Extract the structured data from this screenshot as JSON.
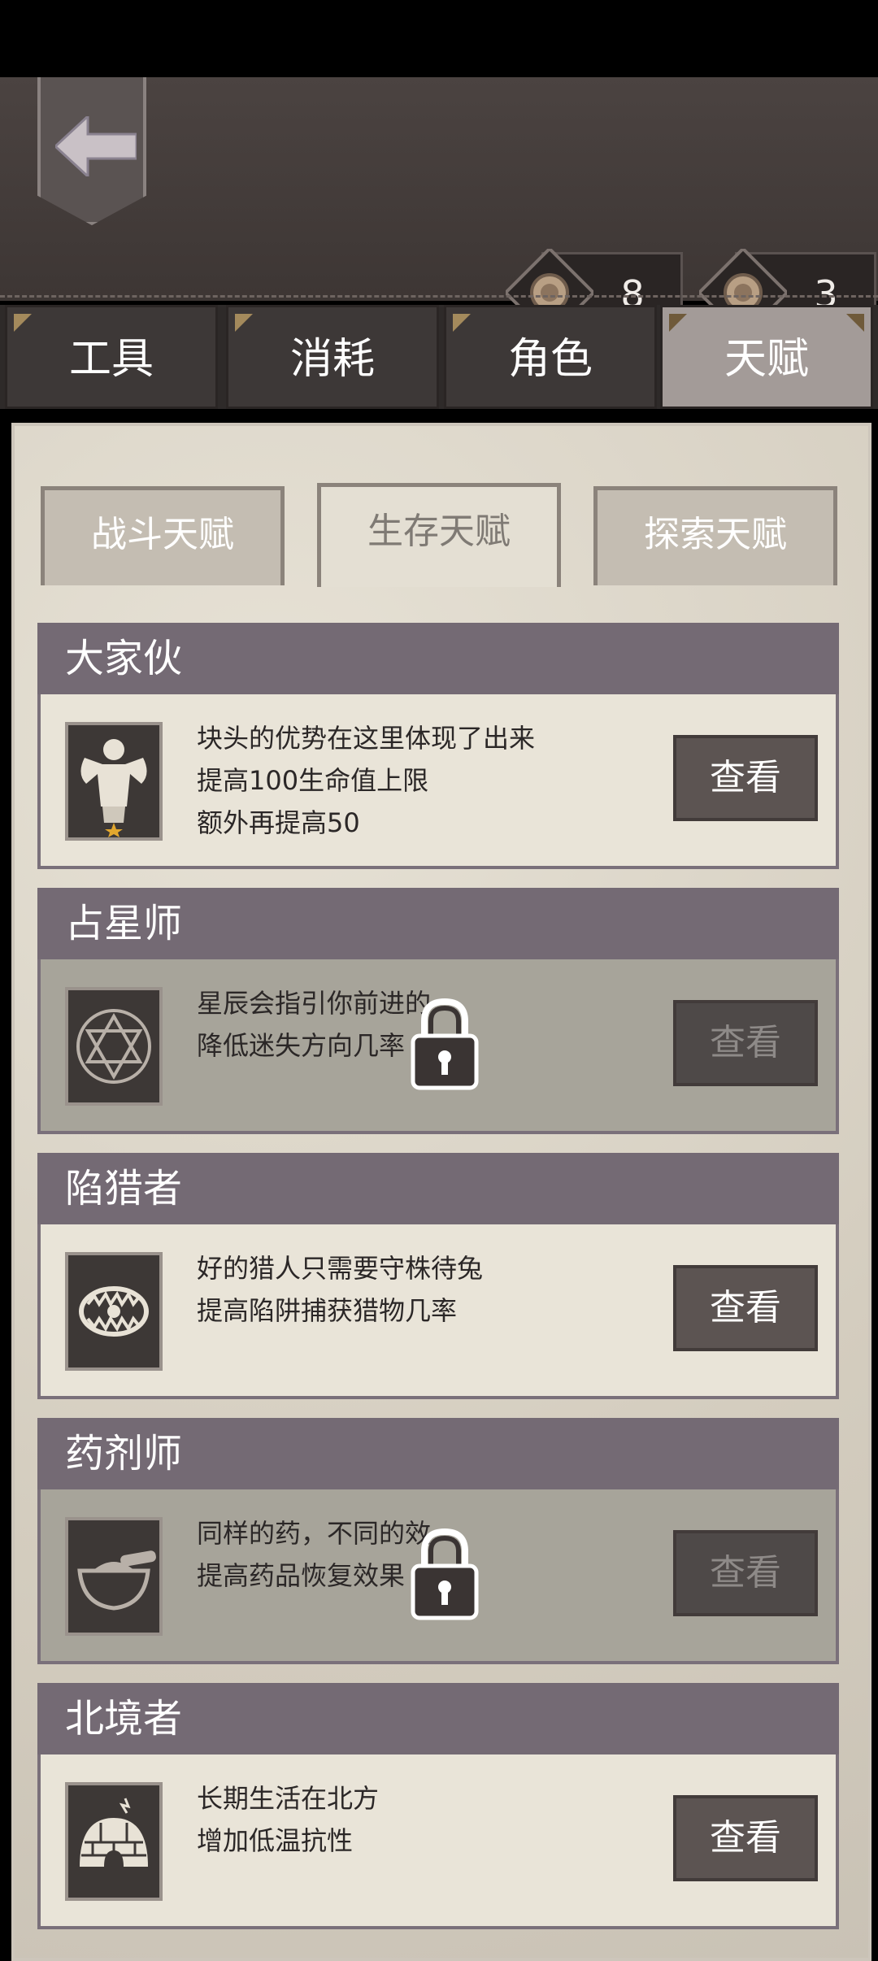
{
  "header": {
    "currency": [
      {
        "name": "coin-a",
        "value": "8"
      },
      {
        "name": "coin-b",
        "value": "3"
      }
    ]
  },
  "tabs": [
    {
      "label": "工具",
      "active": false
    },
    {
      "label": "消耗",
      "active": false
    },
    {
      "label": "角色",
      "active": false
    },
    {
      "label": "天赋",
      "active": true
    }
  ],
  "subtabs": [
    {
      "label": "战斗天赋",
      "active": false
    },
    {
      "label": "生存天赋",
      "active": true
    },
    {
      "label": "探索天赋",
      "active": false
    }
  ],
  "talents": [
    {
      "title": "大家伙",
      "icon": "muscle-man-icon",
      "lines": [
        "块头的优势在这里体现了出来",
        "提高100生命值上限",
        "额外再提高50"
      ],
      "button": "查看",
      "locked": false
    },
    {
      "title": "占星师",
      "icon": "hexagram-icon",
      "lines": [
        "星辰会指引你前进的",
        "降低迷失方向几率"
      ],
      "button": "查看",
      "locked": true
    },
    {
      "title": "陷猎者",
      "icon": "bear-trap-icon",
      "lines": [
        "好的猎人只需要守株待兔",
        "提高陷阱捕获猎物几率"
      ],
      "button": "查看",
      "locked": false
    },
    {
      "title": "药剂师",
      "icon": "mortar-pestle-icon",
      "lines": [
        "同样的药，不同的效",
        "提高药品恢复效果"
      ],
      "button": "查看",
      "locked": true
    },
    {
      "title": "北境者",
      "icon": "igloo-icon",
      "lines": [
        "长期生活在北方",
        "增加低温抗性"
      ],
      "button": "查看",
      "locked": false
    }
  ],
  "colors": {
    "accent": "#746a74",
    "panel": "#d8d2c6",
    "button": "#5c5452"
  }
}
